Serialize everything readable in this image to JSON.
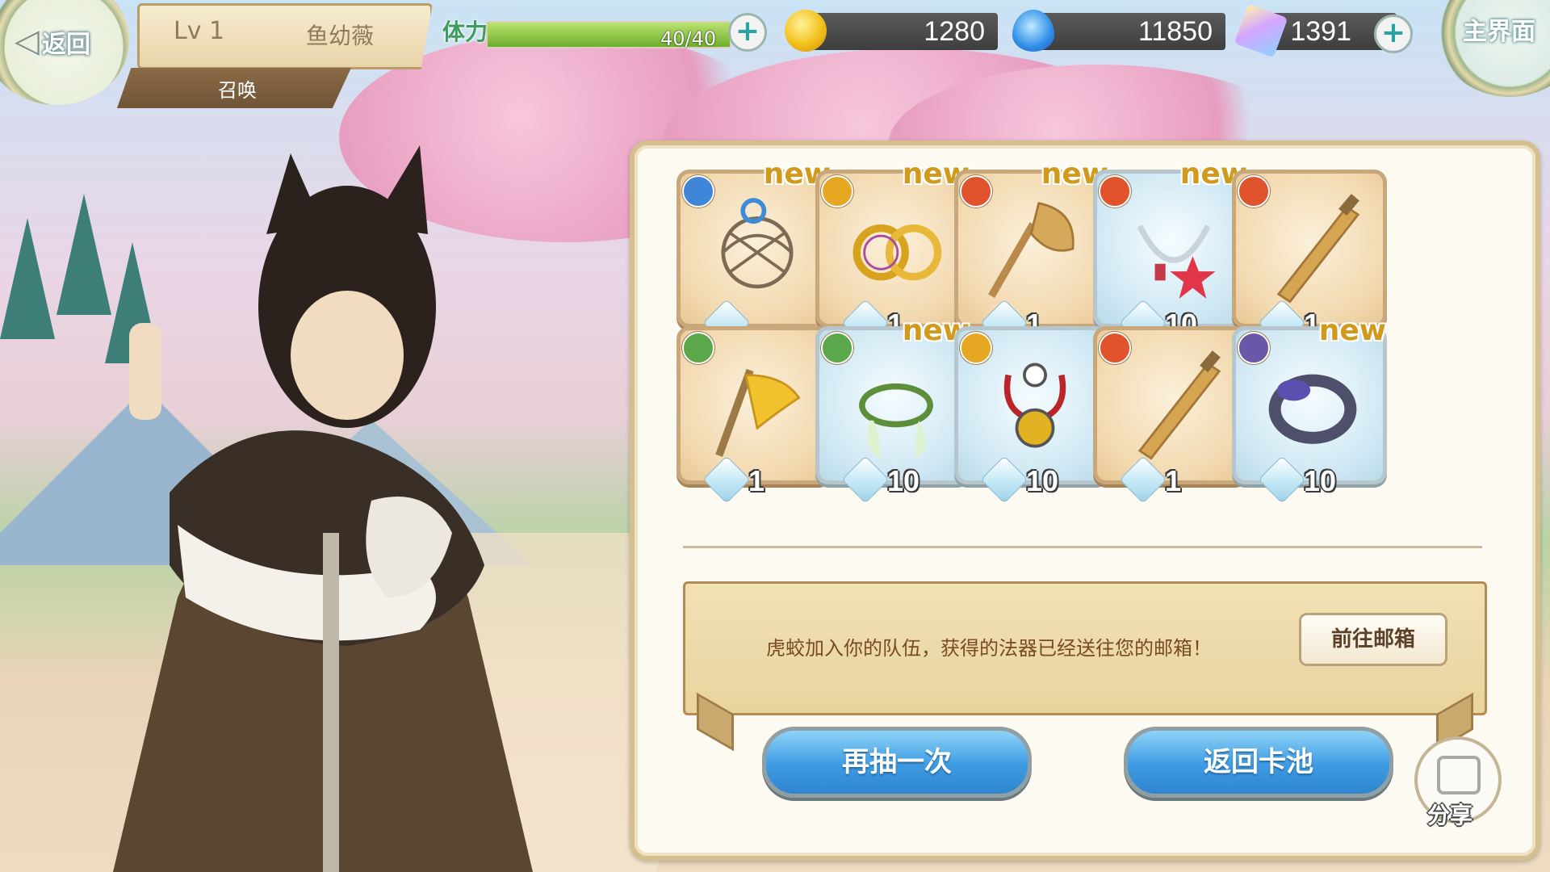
{
  "header": {
    "back_label": "返回",
    "player_level": "Lv 1",
    "player_name": "鱼幼薇",
    "mode_tab": "召唤",
    "home_label": "主界面"
  },
  "resources": {
    "stamina_label": "体力",
    "stamina_value": "40/40",
    "stamina_fraction": 1.0,
    "gold": "1280",
    "spirit": "11850",
    "crystal": "1391"
  },
  "results": {
    "items": [
      {
        "new": true,
        "new_label": "new",
        "element": "water",
        "count": "",
        "frame": "gold",
        "icon": "rope-net-icon"
      },
      {
        "new": true,
        "new_label": "new",
        "element": "light",
        "count": "1",
        "frame": "gold",
        "icon": "gold-rings-icon"
      },
      {
        "new": true,
        "new_label": "new",
        "element": "fire",
        "count": "1",
        "frame": "gold",
        "icon": "axe-icon"
      },
      {
        "new": true,
        "new_label": "new",
        "element": "fire",
        "count": "10",
        "frame": "blue",
        "icon": "star-necklace-icon"
      },
      {
        "new": false,
        "new_label": "",
        "element": "fire",
        "count": "1",
        "frame": "gold",
        "icon": "sword-icon"
      },
      {
        "new": false,
        "new_label": "",
        "element": "wind",
        "count": "1",
        "frame": "gold",
        "icon": "flag-icon"
      },
      {
        "new": true,
        "new_label": "new",
        "element": "wind",
        "count": "10",
        "frame": "blue",
        "icon": "feather-necklace-icon"
      },
      {
        "new": false,
        "new_label": "",
        "element": "light",
        "count": "10",
        "frame": "blue",
        "icon": "pendant-icon"
      },
      {
        "new": false,
        "new_label": "",
        "element": "fire",
        "count": "1",
        "frame": "gold",
        "icon": "sword-icon"
      },
      {
        "new": true,
        "new_label": "new",
        "element": "dark",
        "count": "10",
        "frame": "blue",
        "icon": "bracelet-icon"
      }
    ],
    "message": "虎蛟加入你的队伍，获得的法器已经送往您的邮箱！",
    "mail_button": "前往邮箱",
    "draw_again": "再抽一次",
    "return_pool": "返回卡池",
    "share": "分享"
  },
  "colors": {
    "fire": "#e0532d",
    "water": "#3f86d8",
    "wind": "#5aa84a",
    "light": "#e6a823",
    "dark": "#6b57a8"
  }
}
